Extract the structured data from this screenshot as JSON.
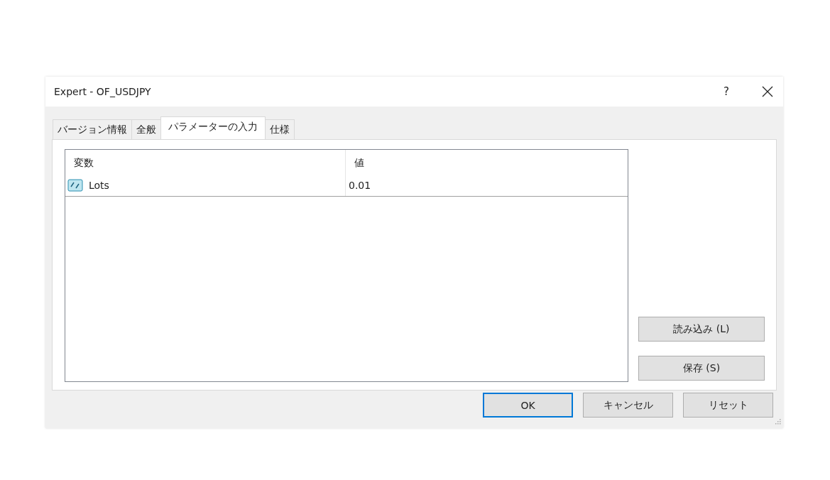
{
  "window": {
    "title": "Expert - OF_USDJPY",
    "help": "?"
  },
  "tabs": [
    {
      "label": "バージョン情報",
      "selected": false
    },
    {
      "label": "全般",
      "selected": false
    },
    {
      "label": "パラメーターの入力",
      "selected": true
    },
    {
      "label": "仕様",
      "selected": false
    }
  ],
  "table": {
    "columns": [
      "変数",
      "値"
    ],
    "rows": [
      {
        "name": "Lots",
        "value": "0.01"
      }
    ]
  },
  "side_buttons": [
    "読み込み (L)",
    "保存 (S)"
  ],
  "buttons": [
    {
      "label": "OK",
      "default": true
    },
    {
      "label": "キャンセル",
      "default": false
    },
    {
      "label": "リセット",
      "default": false
    }
  ]
}
